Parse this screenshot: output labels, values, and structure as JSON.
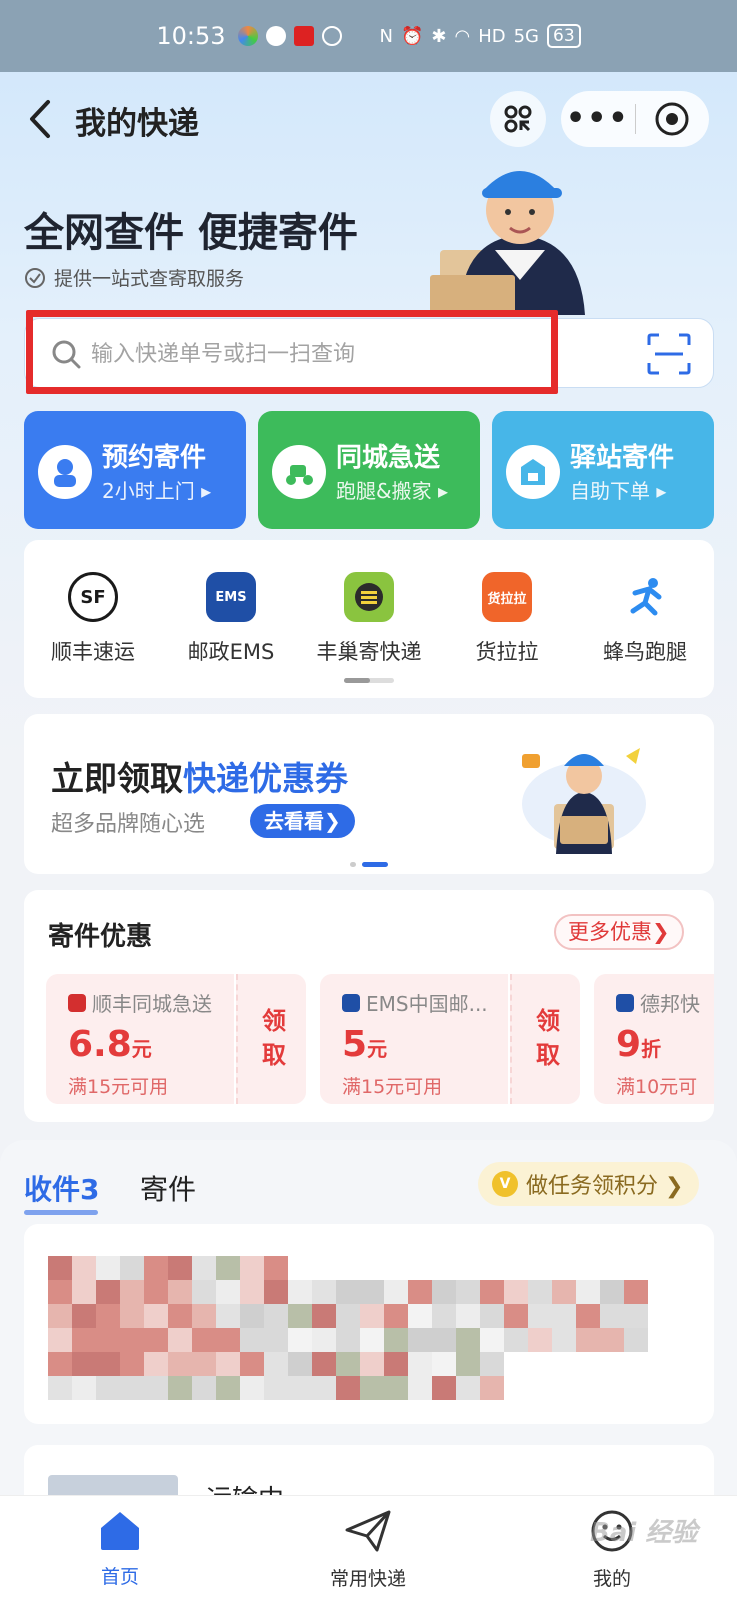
{
  "status_bar": {
    "time": "10:53",
    "hd_label": "HD",
    "net_label": "5G",
    "battery": "63"
  },
  "nav": {
    "title": "我的快递"
  },
  "hero": {
    "title": "全网查件 便捷寄件",
    "subtitle": "提供一站式查寄取服务"
  },
  "search": {
    "placeholder": "输入快递单号或扫一扫查询"
  },
  "features": [
    {
      "title": "预约寄件",
      "sub": "2小时上门 ▸",
      "color": "#3a7cf0",
      "icon": "courier-icon"
    },
    {
      "title": "同城急送",
      "sub": "跑腿&搬家 ▸",
      "color": "#3dbb5b",
      "icon": "scooter-icon"
    },
    {
      "title": "驿站寄件",
      "sub": "自助下单 ▸",
      "color": "#47b6e8",
      "icon": "station-icon"
    }
  ],
  "carriers": [
    {
      "name": "顺丰速运",
      "logo_text": "SF",
      "color": "#1a1a1a"
    },
    {
      "name": "邮政EMS",
      "logo_text": "EMS",
      "color": "#1f4fa6"
    },
    {
      "name": "丰巢寄快递",
      "logo_text": "巢",
      "color": "#8ac43f"
    },
    {
      "name": "货拉拉",
      "logo_text": "货拉拉",
      "color": "#f0652a"
    },
    {
      "name": "蜂鸟跑腿",
      "logo_text": "",
      "color": "#2d8cf0"
    }
  ],
  "banner": {
    "lead": "立即领取",
    "highlight": "快递优惠券",
    "sub": "超多品牌随心选",
    "cta": "去看看❯"
  },
  "offers": {
    "title": "寄件优惠",
    "more": "更多优惠❯",
    "coupons": [
      {
        "brand": "顺丰同城急送",
        "amount": "6.8",
        "unit": "元",
        "cond": "满15元可用",
        "action": "领取",
        "brand_color": "#d32f2f"
      },
      {
        "brand": "EMS中国邮...",
        "amount": "5",
        "unit": "元",
        "cond": "满15元可用",
        "action": "领取",
        "brand_color": "#1f4fa6"
      },
      {
        "brand": "德邦快",
        "amount": "9",
        "unit": "折",
        "cond": "满10元可",
        "action": "",
        "brand_color": "#1f4fa6"
      }
    ]
  },
  "packages": {
    "tab_receive": "收件3",
    "tab_send": "寄件",
    "task_coin": "V",
    "task": "做任务领积分 ❯",
    "second_status": "运输中"
  },
  "bottom_nav": [
    {
      "label": "首页",
      "active": true
    },
    {
      "label": "常用快递",
      "active": false
    },
    {
      "label": "我的",
      "active": false
    }
  ],
  "watermark": "Bai 经验"
}
